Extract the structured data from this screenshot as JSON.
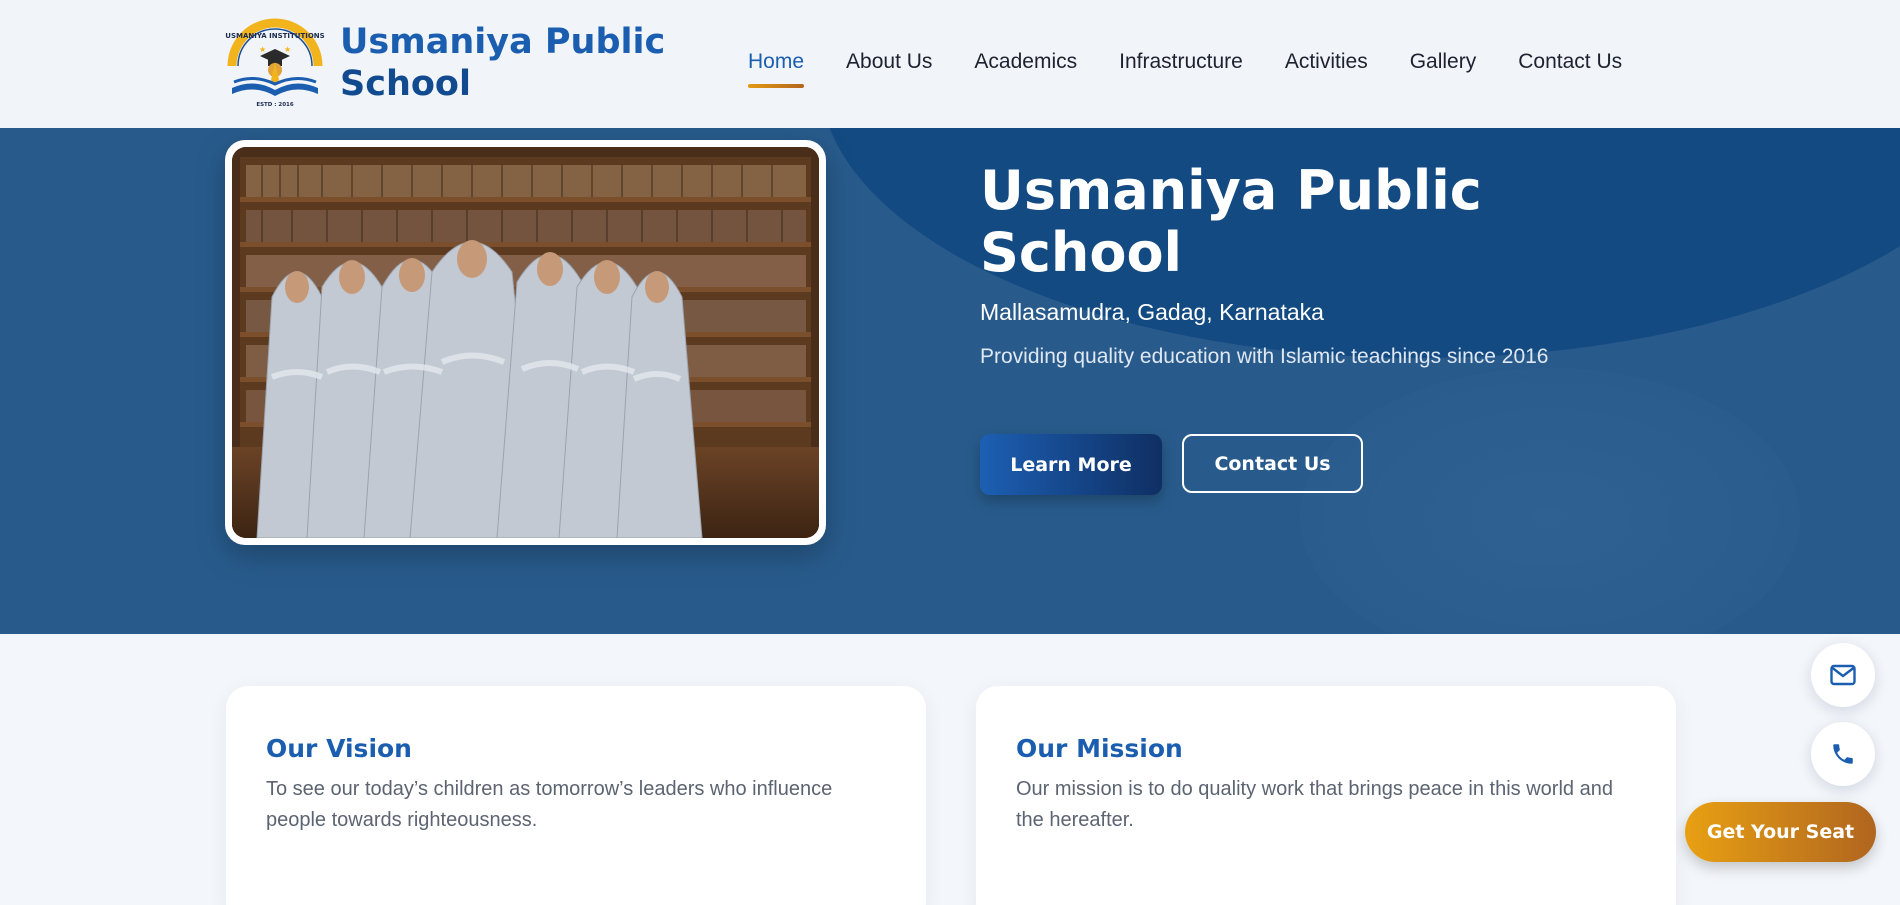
{
  "header": {
    "brand_line1": "Usmaniya Public",
    "brand_line2": "School",
    "logo_text": "USMANIYA INSTITUTIONS",
    "logo_estd": "ESTD : 2016",
    "nav": [
      {
        "label": "Home",
        "active": true
      },
      {
        "label": "About Us"
      },
      {
        "label": "Academics"
      },
      {
        "label": "Infrastructure"
      },
      {
        "label": "Activities"
      },
      {
        "label": "Gallery"
      },
      {
        "label": "Contact Us"
      }
    ]
  },
  "hero": {
    "title_line1": "Usmaniya Public",
    "title_line2": "School",
    "location": "Mallasamudra, Gadag, Karnataka",
    "description": "Providing quality education with Islamic teachings since 2016",
    "learn_more": "Learn More",
    "contact_us": "Contact Us"
  },
  "vision": {
    "title": "Our Vision",
    "text": "To see our today’s children as tomorrow’s leaders who influence people towards righteousness."
  },
  "mission": {
    "title": "Our Mission",
    "text": "Our mission is to do quality work that brings peace in this world and the hereafter."
  },
  "floating": {
    "mail_icon": "mail-icon",
    "phone_icon": "phone-icon",
    "get_seat": "Get Your Seat"
  },
  "colors": {
    "primary": "#1b5eb0",
    "hero_bg": "#285b8c",
    "accent": "#e39a12"
  }
}
